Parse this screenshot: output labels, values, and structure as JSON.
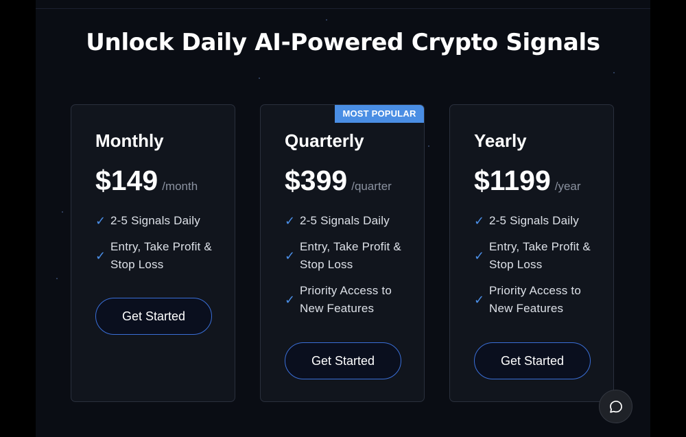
{
  "header": {
    "title": "Unlock Daily AI-Powered Crypto Signals"
  },
  "plans": [
    {
      "name": "Monthly",
      "price": "$149",
      "period": "/month",
      "features": [
        "2-5 Signals Daily",
        "Entry, Take Profit & Stop Loss"
      ],
      "cta_label": "Get Started"
    },
    {
      "name": "Quarterly",
      "price": "$399",
      "period": "/quarter",
      "badge": "MOST POPULAR",
      "features": [
        "2-5 Signals Daily",
        "Entry, Take Profit & Stop Loss",
        "Priority Access to New Features"
      ],
      "cta_label": "Get Started"
    },
    {
      "name": "Yearly",
      "price": "$1199",
      "period": "/year",
      "features": [
        "2-5 Signals Daily",
        "Entry, Take Profit & Stop Loss",
        "Priority Access to New Features"
      ],
      "cta_label": "Get Started"
    }
  ],
  "icons": {
    "check": "check-icon",
    "chat": "chat-bubble-icon"
  },
  "colors": {
    "background": "#0a0d14",
    "card": "#11151d",
    "accent": "#4a8ee4",
    "check": "#4b8fe8",
    "button_border": "#3a6fd8"
  }
}
